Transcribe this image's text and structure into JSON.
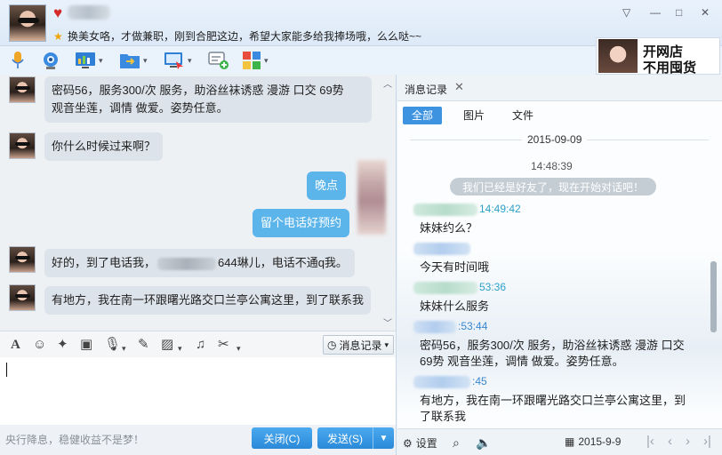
{
  "header": {
    "heart_icon": "heart-icon",
    "signature": "换美女咯，才做兼职，刚到合肥这边，希望大家能多给我捧场哦，么么哒~~",
    "window_controls": [
      "▽",
      "—",
      "□",
      "✕"
    ]
  },
  "ad": {
    "line1": "开网店",
    "line2": "不用囤货"
  },
  "chat": {
    "messages": [
      {
        "dir": "in",
        "text_line1": "密码56，服务300/次 服务，助浴丝袜诱惑 漫游 口交 69势",
        "text_line2": "观音坐莲，调情 做爱。姿势任意。"
      },
      {
        "dir": "in",
        "text": "你什么时候过来啊？"
      },
      {
        "dir": "out",
        "text": "晚点"
      },
      {
        "dir": "out",
        "text": "留个电话好预约"
      },
      {
        "dir": "in",
        "text_before": "好的，到了电话我，",
        "text_after": "644琳儿，电话不通q我。"
      },
      {
        "dir": "in",
        "text": "有地方，我在南一环跟曙光路交口兰亭公寓这里，到了联系我"
      }
    ]
  },
  "input_toolbar": {
    "history_label": "消息记录",
    "caret": "▾"
  },
  "bottom": {
    "slogan": "央行降息，稳健收益不是梦！",
    "close_label": "关闭(C)",
    "send_label": "发送(S)",
    "send_arrow": "▼"
  },
  "history": {
    "tab_label": "消息记录",
    "tab_close": "✕",
    "filters": [
      "全部",
      "图片",
      "文件"
    ],
    "date": "2015-09-09",
    "time": "14:48:39",
    "notice": "我们已经是好友了，现在开始对话吧！",
    "entries": [
      {
        "time": "14:49:42",
        "text": "妹妹约么？"
      },
      {
        "time": "",
        "text": "今天有时间哦"
      },
      {
        "time": "53:36",
        "text": "妹妹什么服务"
      },
      {
        "time": ":53:44",
        "text": "密码56，服务300/次 服务，助浴丝袜诱惑 漫游 口交 69势 观音坐莲，调情 做爱。姿势任意。"
      },
      {
        "time": ":45",
        "text": "有地方，我在南一环跟曙光路交口兰亭公寓这里，到了联系我"
      }
    ],
    "settings_label": "设置",
    "date_footer": "2015-9-9"
  },
  "colors": {
    "accent": "#3d93e0",
    "bubble_out": "#5bb4ea",
    "bubble_in": "#dde3ea"
  }
}
